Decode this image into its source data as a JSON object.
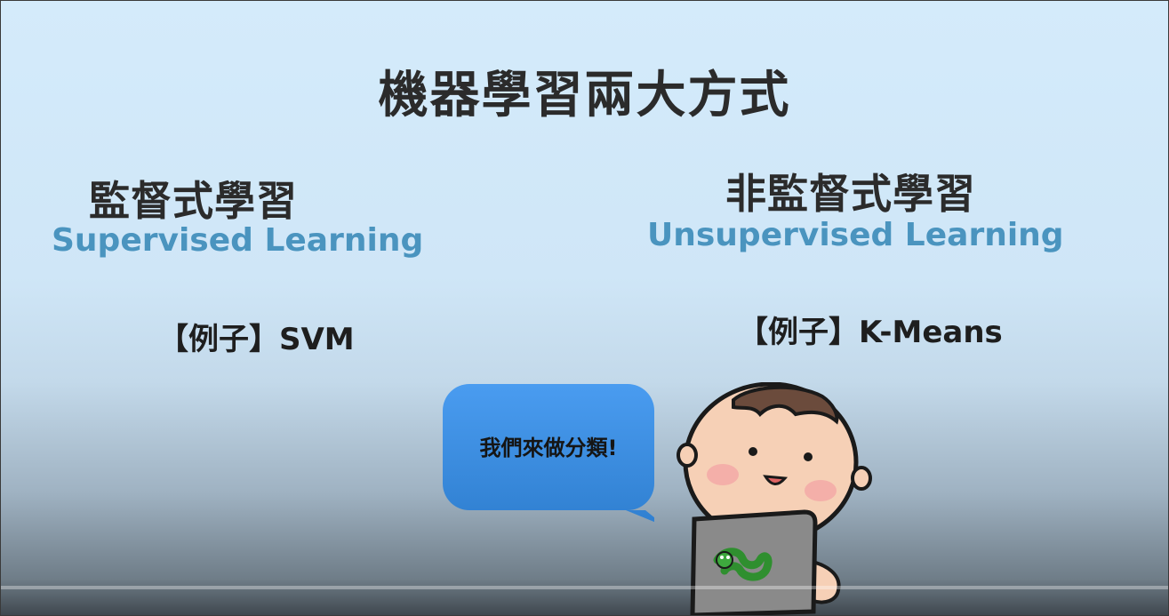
{
  "slide": {
    "title": "機器學習兩大方式",
    "supervised": {
      "heading": "監督式學習",
      "subheading": "Supervised Learning",
      "example": "【例子】SVM"
    },
    "unsupervised": {
      "heading": "非監督式學習",
      "subheading": "Unsupervised Learning",
      "example": "【例子】K-Means"
    },
    "speech_bubble": {
      "text": "我們來做分類!"
    }
  },
  "colors": {
    "subheading": "#4a94bf",
    "bubble": "#3a8ee0",
    "heading": "#2b2b2b"
  },
  "icons": {
    "character": "boy-with-laptop-illustration",
    "laptop_sticker": "green-snake-sticker"
  }
}
